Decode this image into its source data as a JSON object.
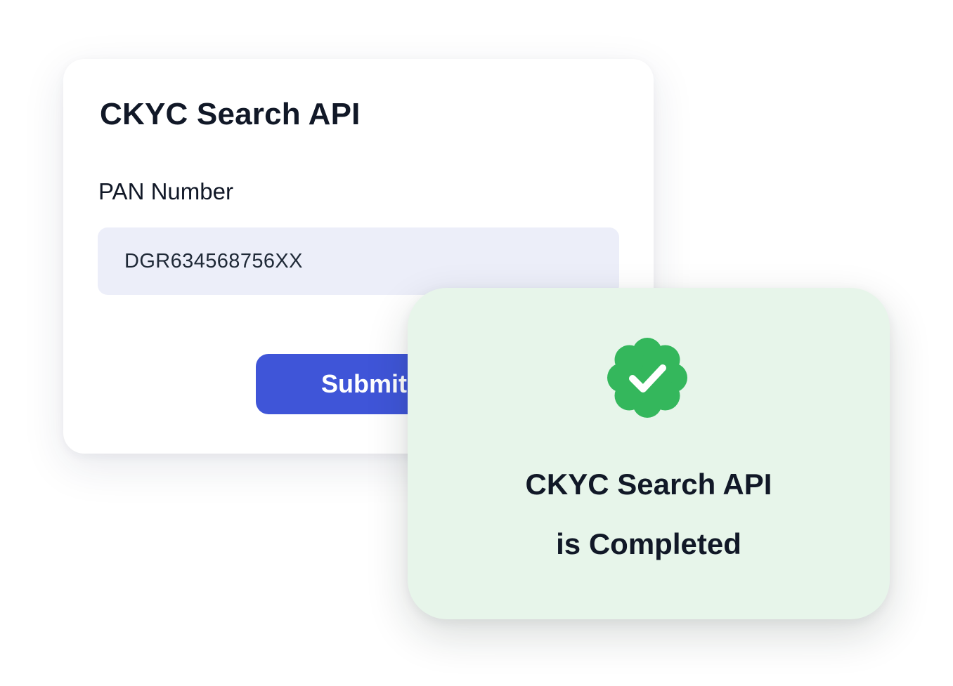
{
  "form": {
    "title": "CKYC Search API",
    "pan_label": "PAN Number",
    "pan_value": "DGR634568756XX",
    "submit_label": "Submit"
  },
  "success": {
    "icon": "verified-check-icon",
    "line1": "CKYC Search API",
    "line2": "is Completed"
  },
  "colors": {
    "primary": "#3f55d8",
    "input_bg": "#eceef9",
    "success_bg": "#e7f5ea",
    "success_green": "#34b75c",
    "text": "#111827"
  }
}
